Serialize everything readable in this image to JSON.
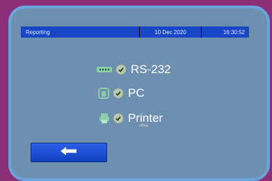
{
  "header": {
    "title": "Reporting",
    "date": "10 Dec 2020",
    "time": "16:30:52"
  },
  "devices": [
    {
      "label": "RS-232",
      "icon": "serial-port-icon",
      "status_icon": "check-icon"
    },
    {
      "label": "PC",
      "icon": "pc-port-icon",
      "status_icon": "check-icon"
    },
    {
      "label": "Printer",
      "icon": "printer-icon",
      "status_icon": "check-icon",
      "status_text": "offline"
    }
  ],
  "footer": {
    "back_icon": "arrow-left-icon"
  },
  "colors": {
    "header_bar": "#1946c4",
    "back_button": "#1e4fd8",
    "icon_accent": "#8acfa8",
    "check": "#b8c8a8",
    "screen": "#030303",
    "bezel": "#69a4dc",
    "background": "#8a2f78"
  }
}
